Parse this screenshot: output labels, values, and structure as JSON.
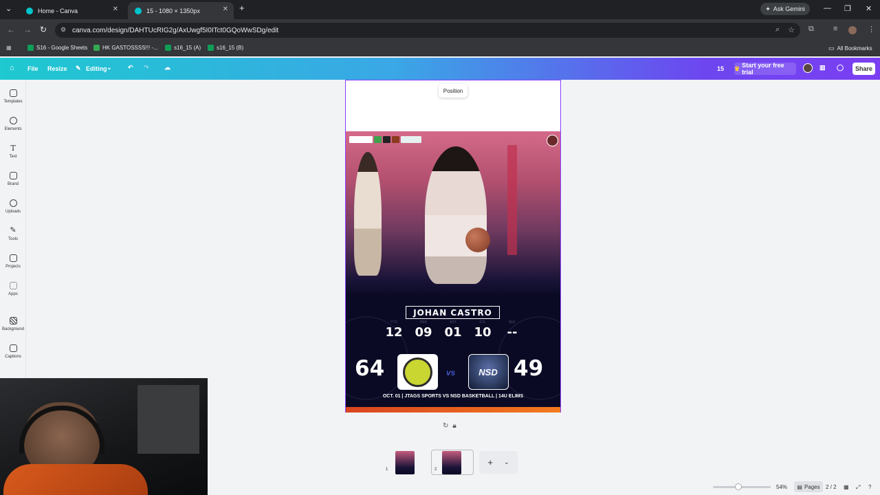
{
  "browser": {
    "tabs": [
      {
        "label": "Home - Canva"
      },
      {
        "label": "15 - 1080 × 1350px"
      }
    ],
    "ask_gemini": "Ask Gemini",
    "url": "canva.com/design/DAHTUcRIG2g/AxUwgf5I0ITct0GQoWwSDg/edit",
    "bookmarks": [
      {
        "label": "S16 - Google Sheets"
      },
      {
        "label": "HK GASTOSSSS!!! -..."
      },
      {
        "label": "s16_15 (A)"
      },
      {
        "label": "s16_15 (B)"
      }
    ],
    "all_bookmarks": "All Bookmarks"
  },
  "canva_toolbar": {
    "file": "File",
    "resize": "Resize",
    "editing": "Editing",
    "page_count": "15",
    "trial": "Start your free trial",
    "share": "Share"
  },
  "sidebar": {
    "items": [
      {
        "label": "Templates"
      },
      {
        "label": "Elements"
      },
      {
        "label": "Text"
      },
      {
        "label": "Brand"
      },
      {
        "label": "Uploads"
      },
      {
        "label": "Tools"
      },
      {
        "label": "Projects"
      },
      {
        "label": "Apps"
      },
      {
        "label": "Background"
      },
      {
        "label": "Captions"
      }
    ]
  },
  "canvas": {
    "tooltip": "Position",
    "player_name": "JOHAN CASTRO",
    "stats": [
      {
        "label": "PTS",
        "value": "12"
      },
      {
        "label": "REB",
        "value": "09"
      },
      {
        "label": "AST",
        "value": "01"
      },
      {
        "label": "STL",
        "value": "10"
      },
      {
        "label": "BLK",
        "value": "--"
      }
    ],
    "home_score": "64",
    "away_score": "49",
    "vs": "vs",
    "away_logo_text": "NSD",
    "caption": "OCT. 01 | JTAGS SPORTS VS NSD BASKETBALL | 14U ELIMS"
  },
  "pages_strip": {
    "thumbs": [
      {
        "num": "1"
      },
      {
        "num": "2"
      }
    ],
    "add": "+"
  },
  "status": {
    "zoom": "54%",
    "zoom_level": 0.54,
    "pages_label": "Pages",
    "page_indicator": "2 / 2"
  },
  "colors": {
    "accent": "#8b3dff",
    "toolbar_start": "#1ec9d0",
    "toolbar_end": "#7b3ff2",
    "poster_bg": "#0a0a24",
    "orange": "#f47a1f"
  }
}
